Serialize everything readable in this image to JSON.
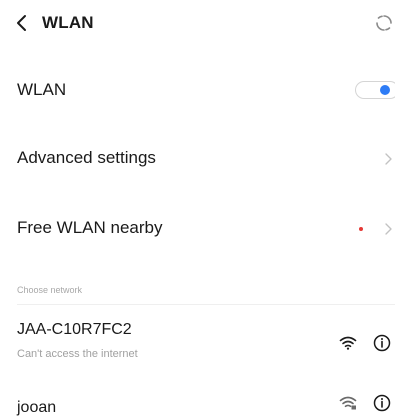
{
  "header": {
    "title": "WLAN",
    "back_icon": "chevron-left-icon",
    "refresh_icon": "refresh-icon"
  },
  "settings": {
    "wlan_label": "WLAN",
    "wlan_enabled": true,
    "advanced_label": "Advanced settings",
    "free_wlan_label": "Free WLAN nearby"
  },
  "networks": {
    "section_label": "Choose network",
    "items": [
      {
        "name": "JAA-C10R7FC2",
        "status": "Can't access the internet",
        "signal": "wifi-strong-icon",
        "info": "info-icon"
      },
      {
        "name": "jooan",
        "signal": "wifi-locked-icon",
        "info": "info-icon"
      }
    ]
  },
  "colors": {
    "accent": "#2e7cf6",
    "new_dot": "#e53935",
    "secondary_text": "#a0a0a0"
  }
}
